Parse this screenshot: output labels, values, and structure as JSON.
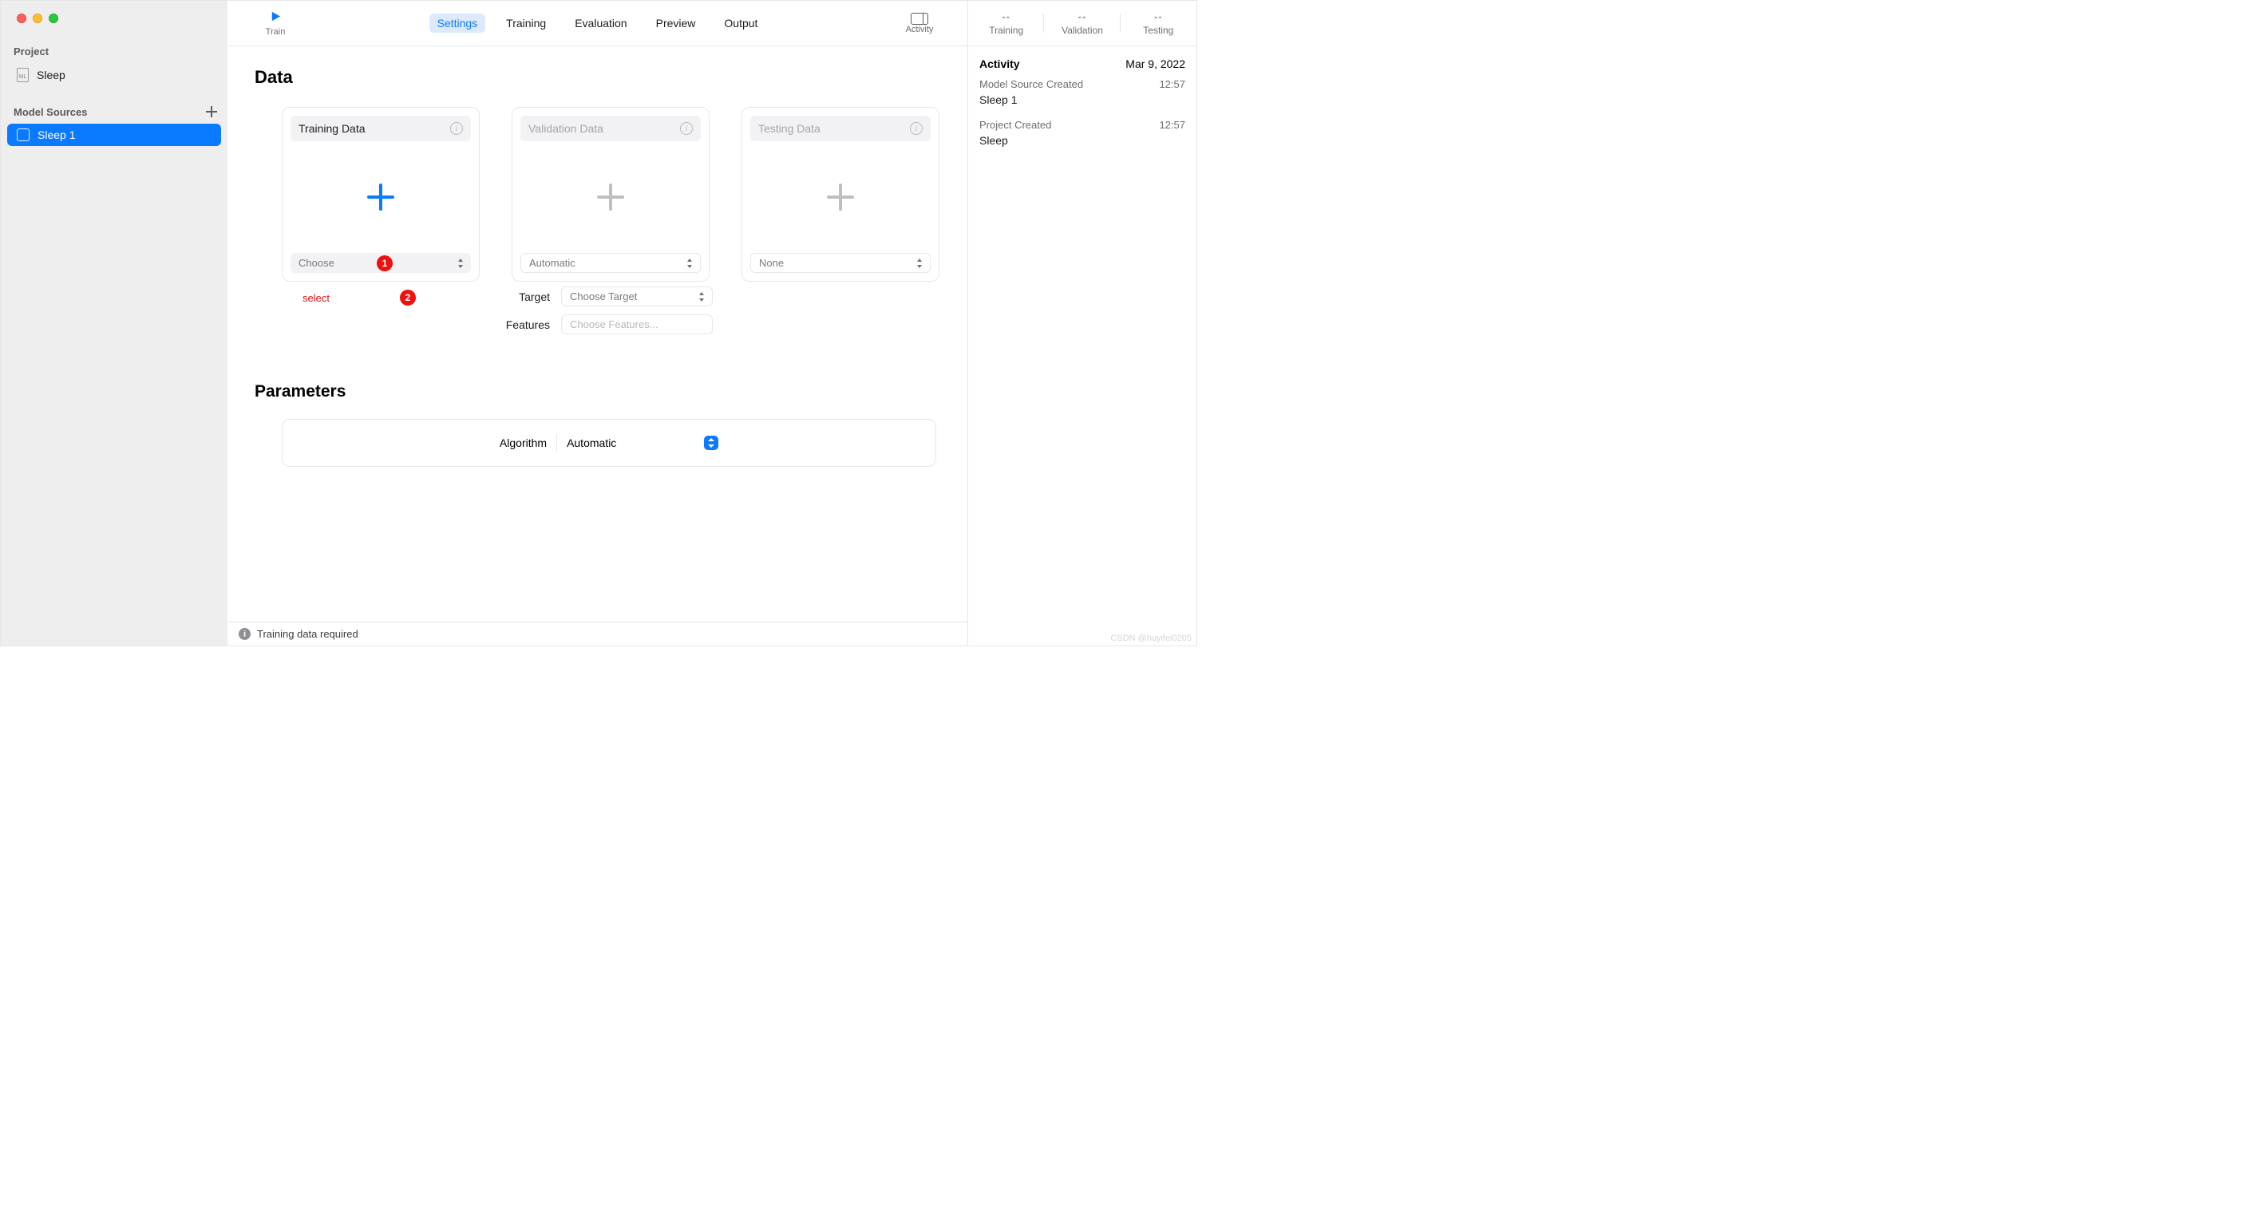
{
  "sidebar": {
    "project_heading": "Project",
    "project_item": "Sleep",
    "sources_heading": "Model Sources",
    "source_item": "Sleep 1"
  },
  "toolbar": {
    "train": "Train",
    "tabs": [
      "Settings",
      "Training",
      "Evaluation",
      "Preview",
      "Output"
    ],
    "active_tab": 0,
    "activity": "Activity"
  },
  "sections": {
    "data": "Data",
    "parameters": "Parameters"
  },
  "cards": {
    "training": {
      "title": "Training Data",
      "select": "Choose"
    },
    "validation": {
      "title": "Validation Data",
      "select": "Automatic"
    },
    "testing": {
      "title": "Testing Data",
      "select": "None"
    }
  },
  "annotations": {
    "select_label": "select",
    "n1": "1",
    "n2": "2"
  },
  "form": {
    "target_label": "Target",
    "target_placeholder": "Choose Target",
    "features_label": "Features",
    "features_placeholder": "Choose Features..."
  },
  "params": {
    "algorithm_label": "Algorithm",
    "algorithm_value": "Automatic"
  },
  "status": {
    "text": "Training data required"
  },
  "metrics": {
    "placeholder": "--",
    "training": "Training",
    "validation": "Validation",
    "testing": "Testing"
  },
  "activity": {
    "heading": "Activity",
    "date": "Mar 9, 2022",
    "items": [
      {
        "title": "Model Source Created",
        "time": "12:57",
        "sub": "Sleep 1"
      },
      {
        "title": "Project Created",
        "time": "12:57",
        "sub": "Sleep"
      }
    ]
  },
  "watermark": "CSDN @huyifei0205"
}
